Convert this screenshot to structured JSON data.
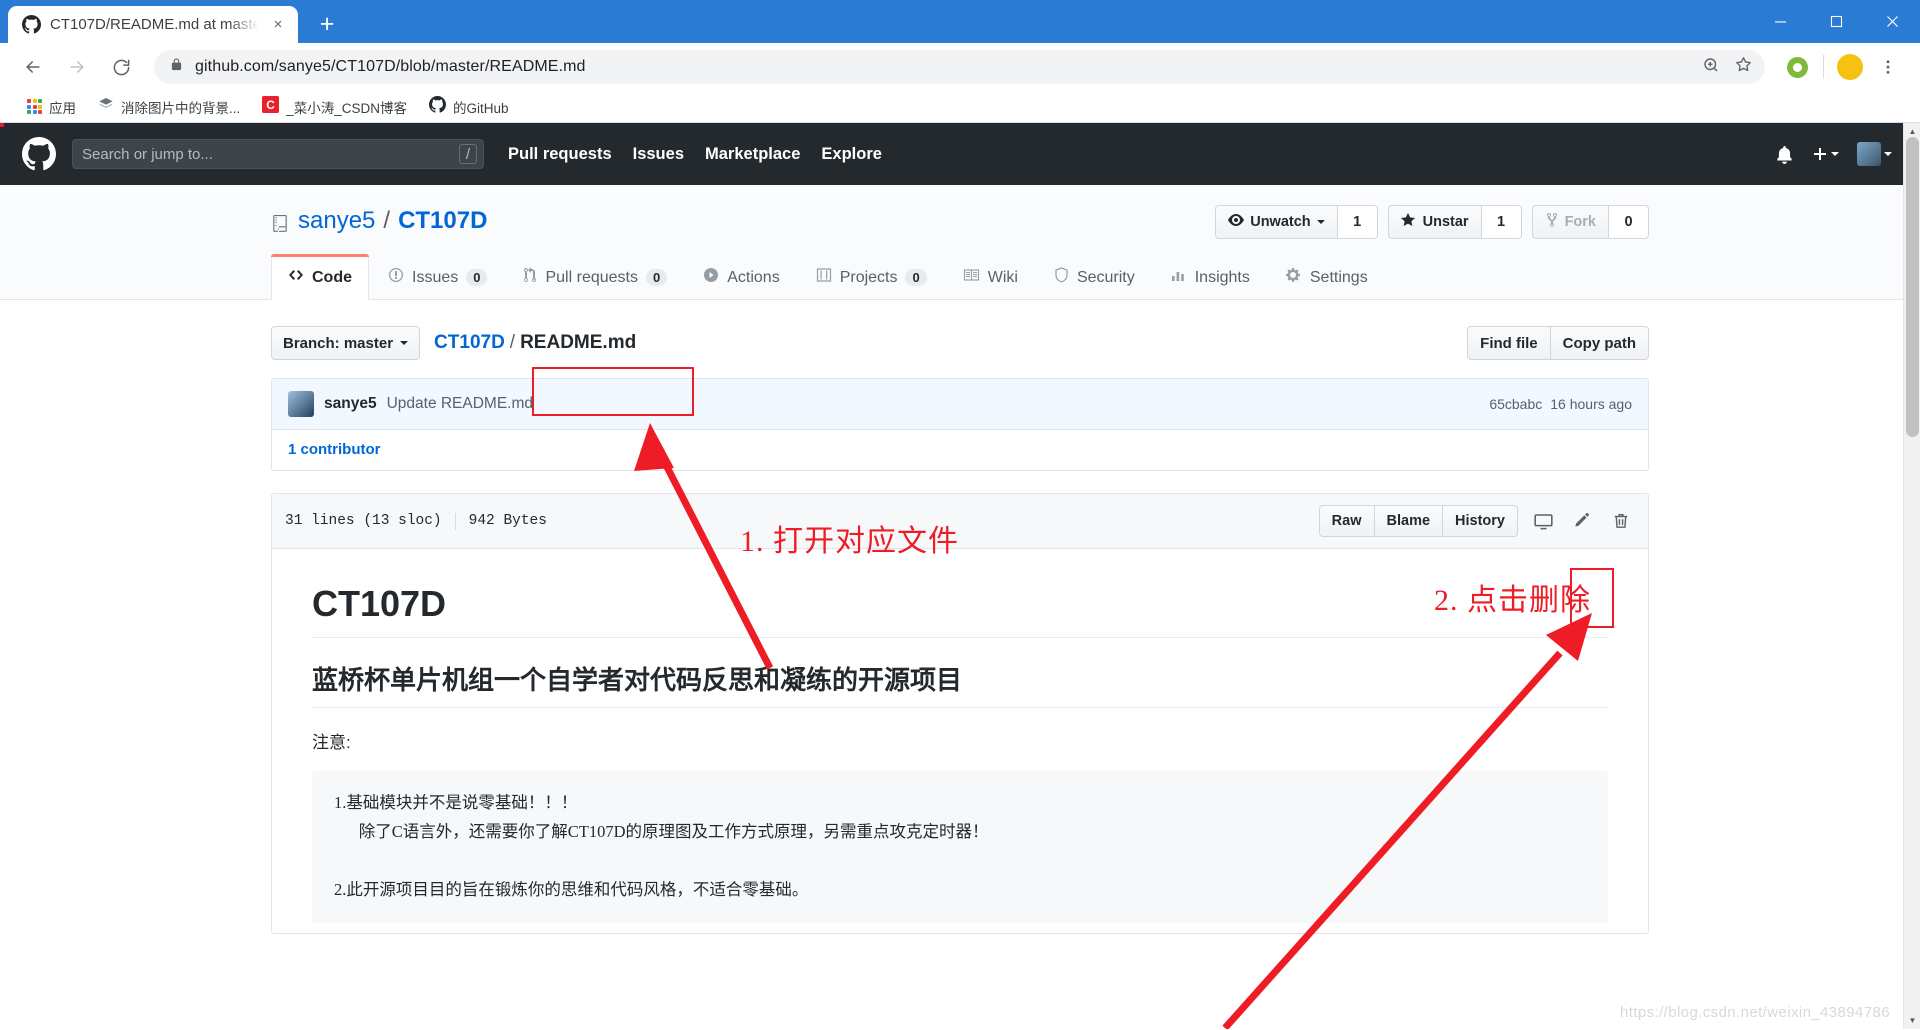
{
  "browser": {
    "tab": {
      "title": "CT107D/README.md at maste",
      "favicon": "github-icon",
      "close": "×"
    },
    "new_tab_label": "+",
    "window_controls": [
      "minimize",
      "maximize",
      "close"
    ],
    "nav": {
      "back": "back-arrow",
      "forward": "forward-arrow",
      "reload": "reload-icon"
    },
    "omnibox": {
      "url": "github.com/sanye5/CT107D/blob/master/README.md",
      "lock": "lock-icon",
      "zoom": "zoom-icon",
      "bookmark": "star-icon"
    },
    "toolbar_icons": [
      "extension-icon",
      "profile-avatar",
      "menu-icon"
    ],
    "profile_initial": "",
    "bookmarks": [
      {
        "label": "应用",
        "icon": "apps-grid-icon"
      },
      {
        "label": "消除图片中的背景...",
        "icon": "layers-icon"
      },
      {
        "label": "_菜小涛_CSDN博客",
        "icon": "csdn-icon"
      },
      {
        "label": "的GitHub",
        "icon": "github-icon"
      }
    ]
  },
  "github": {
    "header": {
      "logo": "github-mark-icon",
      "search_placeholder": "Search or jump to...",
      "search_shortcut": "/",
      "nav": [
        "Pull requests",
        "Issues",
        "Marketplace",
        "Explore"
      ],
      "bell": "bell-icon",
      "plus": "plus-icon",
      "avatar": "user-avatar"
    },
    "repo": {
      "owner": "sanye5",
      "separator": "/",
      "name": "CT107D",
      "icon": "repo-icon",
      "actions": [
        {
          "label": "Unwatch",
          "icon": "eye-icon",
          "count": "1",
          "caret": true,
          "disabled": false
        },
        {
          "label": "Unstar",
          "icon": "star-filled-icon",
          "count": "1",
          "caret": false,
          "disabled": false
        },
        {
          "label": "Fork",
          "icon": "fork-icon",
          "count": "0",
          "caret": false,
          "disabled": true
        }
      ],
      "tabs": [
        {
          "label": "Code",
          "icon": "code-icon",
          "count": null,
          "active": true
        },
        {
          "label": "Issues",
          "icon": "issue-icon",
          "count": "0",
          "active": false
        },
        {
          "label": "Pull requests",
          "icon": "pull-request-icon",
          "count": "0",
          "active": false
        },
        {
          "label": "Actions",
          "icon": "play-icon",
          "count": null,
          "active": false
        },
        {
          "label": "Projects",
          "icon": "project-board-icon",
          "count": "0",
          "active": false
        },
        {
          "label": "Wiki",
          "icon": "book-icon",
          "count": null,
          "active": false
        },
        {
          "label": "Security",
          "icon": "shield-icon",
          "count": null,
          "active": false
        },
        {
          "label": "Insights",
          "icon": "graph-icon",
          "count": null,
          "active": false
        },
        {
          "label": "Settings",
          "icon": "gear-icon",
          "count": null,
          "active": false
        }
      ]
    },
    "file_nav": {
      "branch_label": "Branch: master",
      "breadcrumb_root": "CT107D",
      "breadcrumb_sep": "/",
      "breadcrumb_file": "README.md",
      "find_file": "Find file",
      "copy_path": "Copy path"
    },
    "commit": {
      "author": "sanye5",
      "message": "Update README.md",
      "sha": "65cbabc",
      "time": "16 hours ago",
      "contributors": "1 contributor"
    },
    "file_header": {
      "lines": "31 lines (13 sloc)",
      "size": "942 Bytes",
      "raw": "Raw",
      "blame": "Blame",
      "history": "History",
      "desktop_icon": "desktop-icon",
      "edit_icon": "pencil-icon",
      "delete_icon": "trash-icon"
    },
    "readme": {
      "h1": "CT107D",
      "h2": "蓝桥杯单片机组一个自学者对代码反思和凝练的开源项目",
      "note_label": "注意:",
      "code_block": "1.基础模块并不是说零基础！！！\n      除了C语言外，还需要你了解CT107D的原理图及工作方式原理，另需重点攻克定时器！\n\n2.此开源项目目的旨在锻炼你的思维和代码风格，不适合零基础。"
    }
  },
  "annotations": {
    "step1": "1. 打开对应文件",
    "step2": "2. 点击删除",
    "color": "#ee1c25"
  },
  "watermark": "https://blog.csdn.net/weixin_43894786"
}
